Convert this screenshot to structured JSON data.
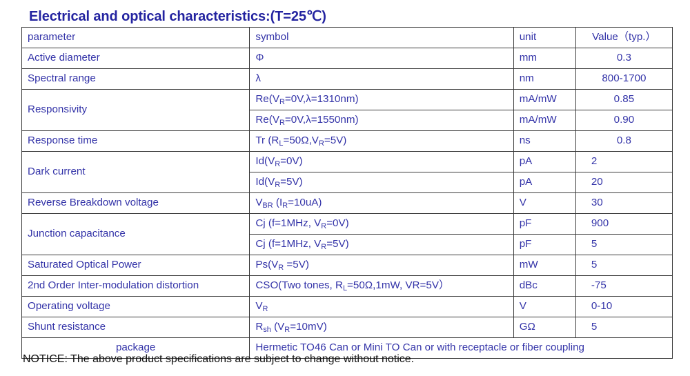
{
  "document": {
    "title": "Electrical and optical characteristics:(T=25℃)",
    "notice": "NOTICE: The above product specifications are subject to change without notice.",
    "text_color": "#3333a8",
    "title_color": "#2323a0",
    "notice_color": "#101010",
    "border_color": "#3a3a3a"
  },
  "table": {
    "headers": {
      "parameter": "parameter",
      "symbol": "symbol",
      "unit": "unit",
      "value": "Value（typ.）"
    },
    "rows": [
      {
        "parameter": "Active diameter",
        "symbol_html": "Φ",
        "symbol_text": "Φ",
        "unit": "mm",
        "value": "0.3"
      },
      {
        "parameter": "Spectral range",
        "symbol_html": "λ",
        "symbol_text": "λ",
        "unit": "nm",
        "value": "800-1700"
      },
      {
        "parameter": "Responsivity",
        "symbol_html": "Re(V<sub>R</sub>=0V,λ=1310nm)",
        "symbol_text": "Re(VR=0V,λ=1310nm)",
        "unit": "mA/mW",
        "value": "0.85"
      },
      {
        "parameter": "",
        "symbol_html": "Re(V<sub>R</sub>=0V,λ=1550nm)",
        "symbol_text": "Re(VR=0V,λ=1550nm)",
        "unit": "mA/mW",
        "value": "0.90"
      },
      {
        "parameter": "Response time",
        "symbol_html": "Tr (R<sub>L</sub>=50Ω,V<sub>R</sub>=5V)",
        "symbol_text": "Tr (RL=50Ω,VR=5V)",
        "unit": "ns",
        "value": "0.8"
      },
      {
        "parameter": "Dark current",
        "symbol_html": "Id(V<sub>R</sub>=0V)",
        "symbol_text": "Id(VR=0V)",
        "unit": "pA",
        "value": "2"
      },
      {
        "parameter": "",
        "symbol_html": "Id(V<sub>R</sub>=5V)",
        "symbol_text": "Id(VR=5V)",
        "unit": "pA",
        "value": "20"
      },
      {
        "parameter": "Reverse Breakdown voltage",
        "symbol_html": "V<sub>BR</sub> (I<sub>R</sub>=10uA)",
        "symbol_text": "VBR (IR=10uA)",
        "unit": "V",
        "value": "30"
      },
      {
        "parameter": "Junction capacitance",
        "symbol_html": "Cj (f=1MHz, V<sub>R</sub>=0V)",
        "symbol_text": "Cj (f=1MHz, VR=0V)",
        "unit": "pF",
        "value": "900"
      },
      {
        "parameter": "",
        "symbol_html": "Cj (f=1MHz, V<sub>R</sub>=5V)",
        "symbol_text": "Cj (f=1MHz, VR=5V)",
        "unit": "pF",
        "value": "5"
      },
      {
        "parameter": "Saturated Optical Power",
        "symbol_html": "Ps(V<sub>R</sub> =5V)",
        "symbol_text": "Ps(VR =5V)",
        "unit": "mW",
        "value": "5"
      },
      {
        "parameter": "2nd Order Inter-modulation distortion",
        "symbol_html": "CSO(Two tones, R<sub>L</sub>=50Ω,1mW, VR=5V）",
        "symbol_text": "CSO(Two tones, RL=50Ω,1mW, VR=5V）",
        "unit": "dBc",
        "value": "-75"
      },
      {
        "parameter": "Operating voltage",
        "symbol_html": "V<sub>R</sub>",
        "symbol_text": "VR",
        "unit": "V",
        "value": "0-10"
      },
      {
        "parameter": "Shunt resistance",
        "symbol_html": "R<sub>sh</sub> (V<sub>R</sub>=10mV)",
        "symbol_text": "Rsh (VR=10mV)",
        "unit": "GΩ",
        "value": "5"
      }
    ],
    "package_row": {
      "parameter": "package",
      "description": "Hermetic TO46 Can or Mini TO Can or with receptacle or fiber coupling"
    }
  }
}
